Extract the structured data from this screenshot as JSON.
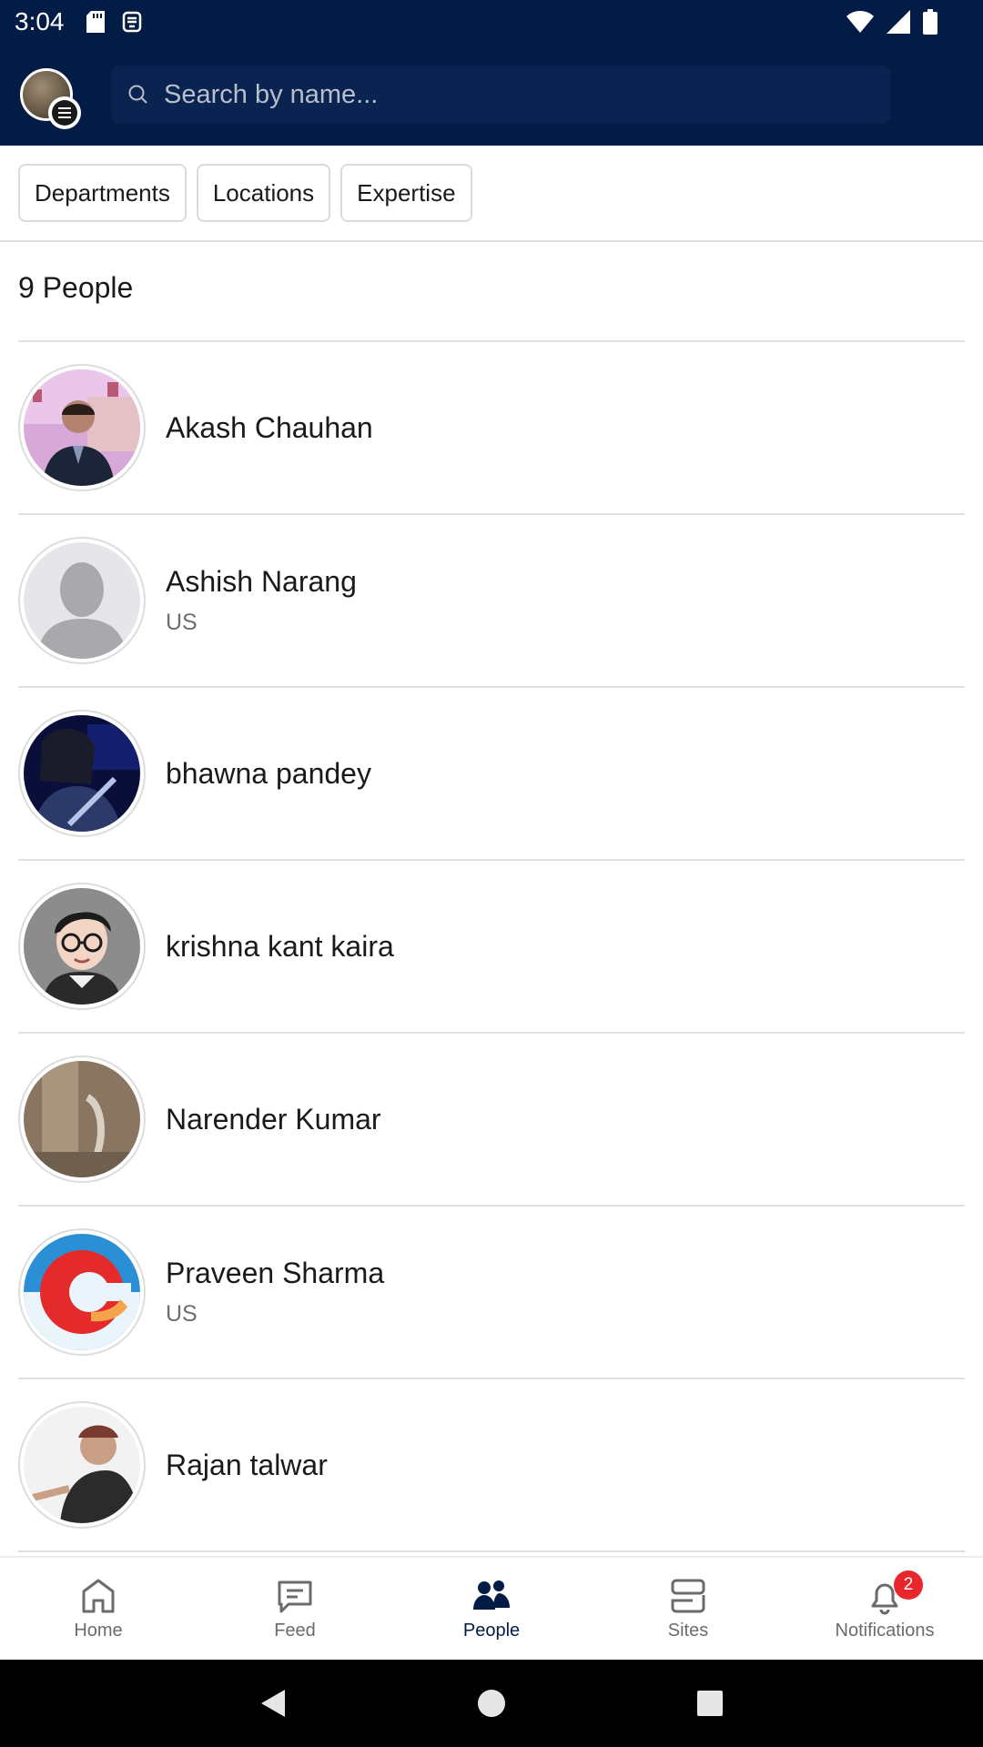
{
  "status_bar": {
    "time": "3:04"
  },
  "header": {
    "search_placeholder": "Search by name..."
  },
  "filters": [
    {
      "label": "Departments"
    },
    {
      "label": "Locations"
    },
    {
      "label": "Expertise"
    }
  ],
  "people_count": "9 People",
  "people": [
    {
      "name": "Akash Chauhan",
      "location": ""
    },
    {
      "name": "Ashish Narang",
      "location": "US"
    },
    {
      "name": "bhawna pandey",
      "location": ""
    },
    {
      "name": "krishna kant kaira",
      "location": ""
    },
    {
      "name": "Narender Kumar",
      "location": ""
    },
    {
      "name": "Praveen Sharma",
      "location": "US"
    },
    {
      "name": "Rajan talwar",
      "location": ""
    }
  ],
  "bottom_nav": {
    "items": [
      {
        "label": "Home",
        "icon": "home-icon"
      },
      {
        "label": "Feed",
        "icon": "feed-icon"
      },
      {
        "label": "People",
        "icon": "people-icon",
        "active": true
      },
      {
        "label": "Sites",
        "icon": "sites-icon"
      },
      {
        "label": "Notifications",
        "icon": "bell-icon",
        "badge": "2"
      }
    ]
  },
  "colors": {
    "header_bg": "#021c45",
    "accent": "#021c45",
    "badge": "#e8262b"
  }
}
